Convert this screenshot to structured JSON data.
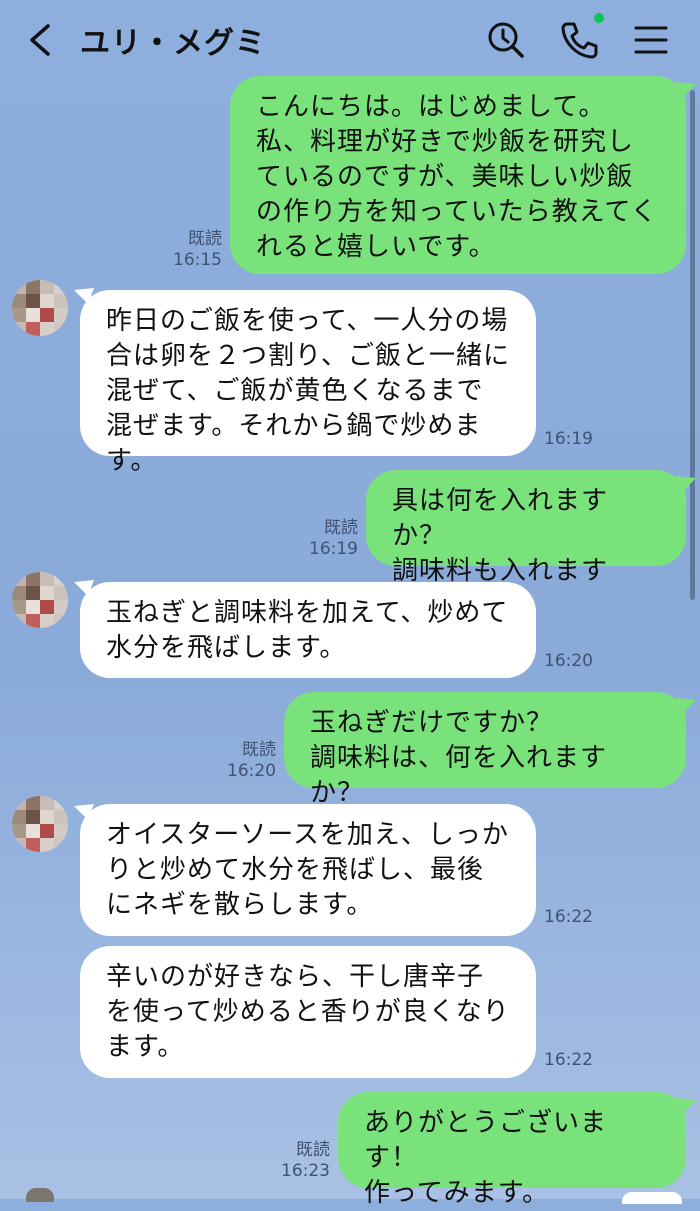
{
  "header": {
    "contact_name": "ユリ・メグミ",
    "icons": [
      "back-arrow-icon",
      "search-icon",
      "phone-icon",
      "menu-icon"
    ],
    "online_indicator_color": "#06c755"
  },
  "messages": [
    {
      "side": "right",
      "text": "こんにちは。はじめまして。\n私、料理が好きで炒飯を研究しているのですが、美味しい炒飯の作り方を知っていたら教えてくれると嬉しいです。",
      "read": "既読",
      "time": "16:15"
    },
    {
      "side": "left",
      "text": "昨日のご飯を使って、一人分の場合は卵を２つ割り、ご飯と一緒に混ぜて、ご飯が黄色くなるまで混ぜます。それから鍋で炒めます。",
      "time": "16:19"
    },
    {
      "side": "right",
      "text": "具は何を入れますか？\n調味料も入れますか？",
      "read": "既読",
      "time": "16:19"
    },
    {
      "side": "left",
      "text": "玉ねぎと調味料を加えて、炒めて水分を飛ばします。",
      "time": "16:20"
    },
    {
      "side": "right",
      "text": "玉ねぎだけですか？\n調味料は、何を入れますか？",
      "read": "既読",
      "time": "16:20"
    },
    {
      "side": "left",
      "text": "オイスターソースを加え、しっかりと炒めて水分を飛ばし、最後にネギを散らします。",
      "time": "16:22"
    },
    {
      "side": "left",
      "text": "辛いのが好きなら、干し唐辛子を使って炒めると香りが良くなります。",
      "time": "16:22"
    },
    {
      "side": "right",
      "text": "ありがとうございます！\n作ってみます。",
      "read": "既読",
      "time": "16:23"
    }
  ],
  "colors": {
    "my_bubble": "#79e27b",
    "their_bubble": "#ffffff",
    "background": "#8eaede"
  }
}
